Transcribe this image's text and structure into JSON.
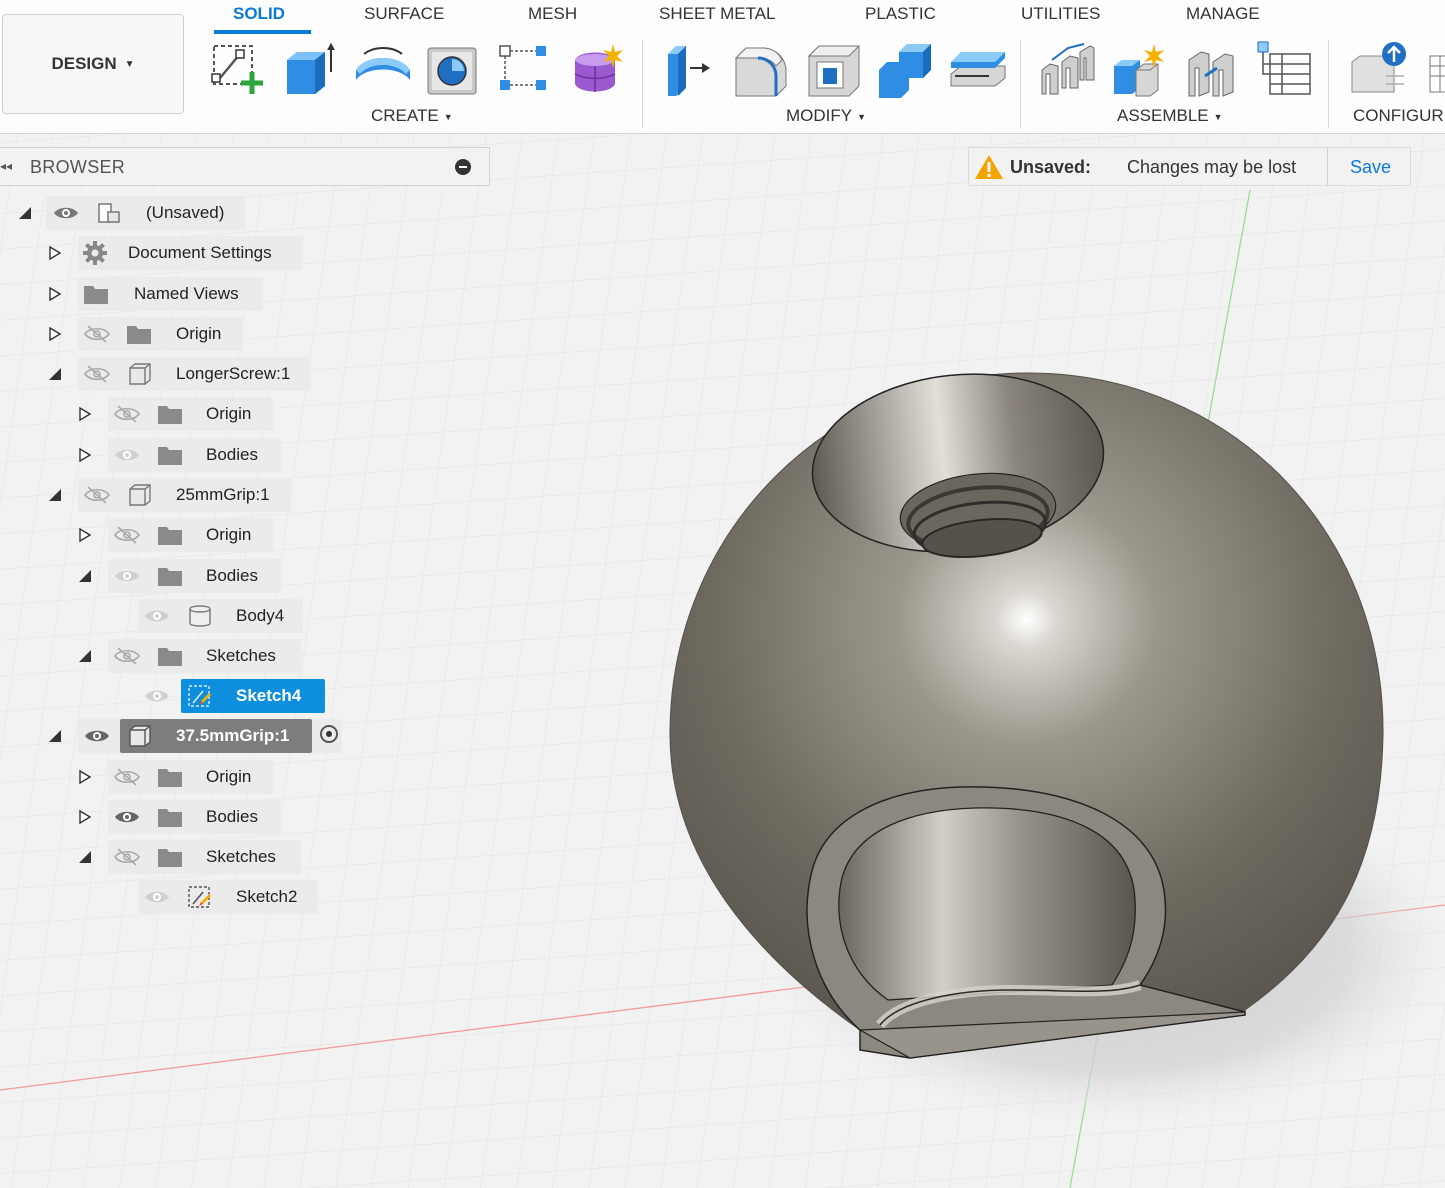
{
  "workspace": {
    "label": "DESIGN"
  },
  "tabs": [
    "SOLID",
    "SURFACE",
    "MESH",
    "SHEET METAL",
    "PLASTIC",
    "UTILITIES",
    "MANAGE"
  ],
  "active_tab": "SOLID",
  "groups": {
    "create": "CREATE",
    "modify": "MODIFY",
    "assemble": "ASSEMBLE",
    "configure": "CONFIGUR"
  },
  "tool_icons": {
    "create": [
      "create-sketch-icon",
      "extrude-icon",
      "revolve-icon",
      "hole-icon",
      "pattern-icon",
      "form-icon"
    ],
    "modify": [
      "press-pull-icon",
      "fillet-icon",
      "shell-icon",
      "combine-icon",
      "offset-face-icon"
    ],
    "assemble": [
      "joint-icon",
      "new-component-icon",
      "as-built-joint-icon",
      "bom-table-icon"
    ],
    "configure": [
      "configure-icon",
      "configure-table-icon"
    ]
  },
  "browser": {
    "title": "BROWSER",
    "tree": [
      {
        "label": "(Unsaved)",
        "icon": "document-icon",
        "eye": "visible"
      },
      {
        "label": "Document Settings",
        "icon": "gear-icon"
      },
      {
        "label": "Named Views",
        "icon": "folder-icon"
      },
      {
        "label": "Origin",
        "icon": "folder-icon",
        "eye": "hidden"
      },
      {
        "label": "LongerScrew:1",
        "icon": "component-icon",
        "eye": "hidden"
      },
      {
        "label": "Origin",
        "icon": "folder-icon",
        "eye": "hidden"
      },
      {
        "label": "Bodies",
        "icon": "folder-icon",
        "eye": "dim"
      },
      {
        "label": "25mmGrip:1",
        "icon": "component-icon",
        "eye": "hidden"
      },
      {
        "label": "Origin",
        "icon": "folder-icon",
        "eye": "hidden"
      },
      {
        "label": "Bodies",
        "icon": "folder-icon",
        "eye": "dim"
      },
      {
        "label": "Body4",
        "icon": "body-icon",
        "eye": "dim"
      },
      {
        "label": "Sketches",
        "icon": "folder-icon",
        "eye": "hidden"
      },
      {
        "label": "Sketch4",
        "icon": "sketch-icon",
        "eye": "dim",
        "selected": true
      },
      {
        "label": "37.5mmGrip:1",
        "icon": "component-icon",
        "eye": "visible",
        "active": true
      },
      {
        "label": "Origin",
        "icon": "folder-icon",
        "eye": "hidden"
      },
      {
        "label": "Bodies",
        "icon": "folder-icon",
        "eye": "visible"
      },
      {
        "label": "Sketches",
        "icon": "folder-icon",
        "eye": "hidden"
      },
      {
        "label": "Sketch2",
        "icon": "sketch-icon",
        "eye": "dim"
      }
    ]
  },
  "unsaved_bar": {
    "label": "Unsaved:",
    "message": "Changes may be lost",
    "save": "Save"
  },
  "colors": {
    "accent": "#0a7ad6",
    "selection": "#0e8fde",
    "warning": "#f5a300",
    "model": "#7f7a70"
  }
}
